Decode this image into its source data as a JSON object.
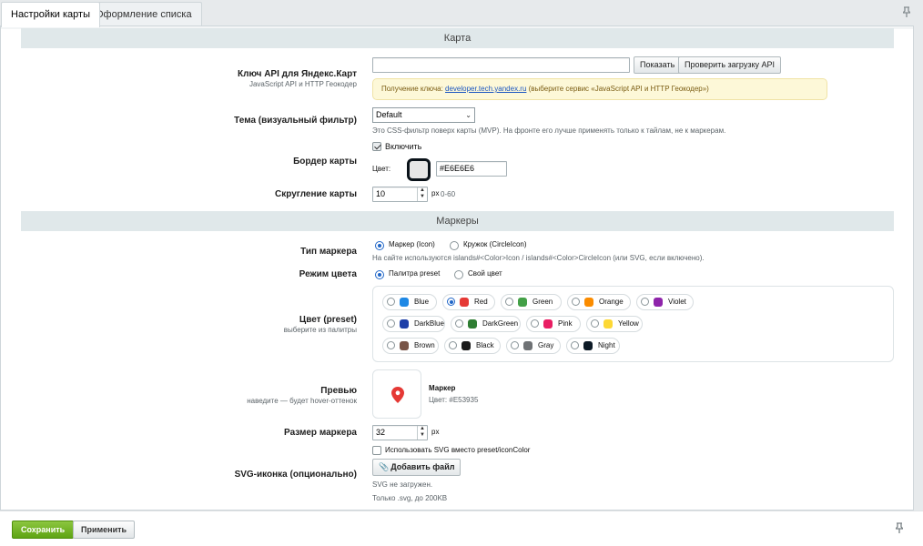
{
  "tabs": [
    {
      "label": "Настройки карты",
      "active": true
    },
    {
      "label": "Оформление списка",
      "active": false
    }
  ],
  "pin_icon": "pin-icon",
  "sections": {
    "map": "Карта",
    "markers": "Маркеры"
  },
  "api_key": {
    "label": "Ключ API для Яндекс.Карт",
    "sub": "JavaScript API и HTTP Геокодер",
    "value": "",
    "show_button": "Показать",
    "check_button": "Проверить загрузку API",
    "note_prefix": "Получение ключа: ",
    "note_link": "developer.tech.yandex.ru",
    "note_suffix": " (выберите сервис «JavaScript API и HTTP Геокодер»)"
  },
  "theme": {
    "label": "Тема (визуальный фильтр)",
    "value": "Default",
    "hint": "Это CSS-фильтр поверх карты (MVP). На фронте его лучше применять только к тайлам, не к маркерам."
  },
  "border": {
    "enable_label": "Включить",
    "enabled": true,
    "label": "Бордер карты",
    "color_label": "Цвет:",
    "color_value": "#E6E6E6"
  },
  "rounding": {
    "label": "Скругление карты",
    "value": "10",
    "unit": "px",
    "range": "0-60"
  },
  "marker_type": {
    "label": "Тип маркера",
    "options": [
      "Маркер (Icon)",
      "Кружок (CircleIcon)"
    ],
    "selected": 0,
    "hint": "На сайте используются islands#<Color>Icon / islands#<Color>CircleIcon (или SVG, если включено)."
  },
  "color_mode": {
    "label": "Режим цвета",
    "options": [
      "Палитра preset",
      "Свой цвет"
    ],
    "selected": 0
  },
  "preset": {
    "label": "Цвет (preset)",
    "sub": "выберите из палитры",
    "selected": "Red",
    "colors": [
      {
        "name": "Blue",
        "hex": "#1e88e5"
      },
      {
        "name": "Red",
        "hex": "#e53935"
      },
      {
        "name": "Green",
        "hex": "#43a047"
      },
      {
        "name": "Orange",
        "hex": "#fb8c00"
      },
      {
        "name": "Violet",
        "hex": "#8e24aa"
      },
      {
        "name": "DarkBlue",
        "hex": "#1e3fa8"
      },
      {
        "name": "DarkGreen",
        "hex": "#2e7d32"
      },
      {
        "name": "Pink",
        "hex": "#e91e63"
      },
      {
        "name": "Yellow",
        "hex": "#fdd835"
      },
      {
        "name": "Brown",
        "hex": "#795548"
      },
      {
        "name": "Black",
        "hex": "#1b1b1b"
      },
      {
        "name": "Gray",
        "hex": "#6f7275"
      },
      {
        "name": "Night",
        "hex": "#0d1a26"
      }
    ]
  },
  "preview": {
    "label": "Превью",
    "sub": "наведите — будет hover-оттенок",
    "title": "Маркер",
    "color_text": "Цвет: #E53935",
    "marker_color": "#e53935"
  },
  "marker_size": {
    "label": "Размер маркера",
    "value": "32",
    "unit": "px"
  },
  "svg_icon": {
    "use_svg_label": "Использовать SVG вместо preset/iconColor",
    "use_svg": false,
    "label": "SVG-иконка (опционально)",
    "add_button": "Добавить файл",
    "status": "SVG не загружен.",
    "limit": "Только .svg, до 200KB"
  },
  "footer": {
    "save": "Сохранить",
    "apply": "Применить"
  }
}
